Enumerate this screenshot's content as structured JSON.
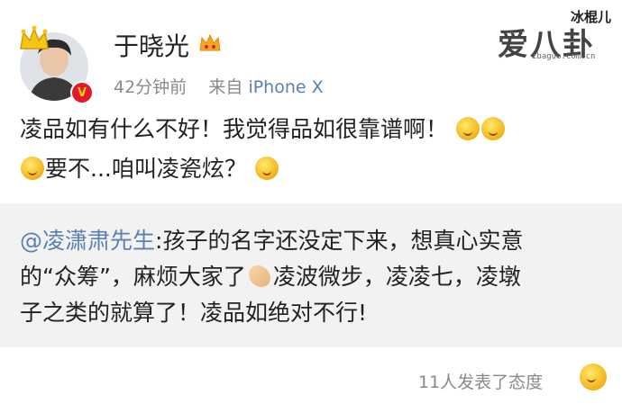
{
  "post": {
    "author": {
      "name": "于晓光",
      "verified_badge": "V"
    },
    "meta": {
      "time": "42分钟前",
      "source_prefix": "来自",
      "source": "iPhone X"
    },
    "text": {
      "line1": "凌品如有什么不好！我觉得品如很靠谱啊！",
      "line2": "要不...咱叫凌瓷炫？"
    },
    "repost": {
      "mention": "@凌潇肃先生",
      "text_part1": ":孩子的名字还没定下来，想真心实意",
      "text_part2": "的“众筹”，麻烦大家了",
      "text_part3": "凌波微步，凌凌七，凌墩",
      "text_part4": "子之类的就算了！凌品如绝对不行!"
    },
    "footer": {
      "reactions": "11人发表了态度"
    }
  },
  "watermark": {
    "brand_small": "冰棍儿",
    "brand_big": "爱八卦",
    "url": "ibaguo.com.cn"
  },
  "icons": {
    "crown": "crown-icon",
    "vip": "vip-crown-icon",
    "emoji_doge": "doge-emoji-icon",
    "emoji_grin": "grin-emoji-icon",
    "emoji_hands": "pray-hands-icon",
    "emoji_laugh": "laugh-emoji-icon"
  },
  "colors": {
    "link": "#5b7fb4",
    "meta": "#8a8a8a",
    "repost_bg": "#f2f2f2",
    "badge": "#e6162d"
  }
}
